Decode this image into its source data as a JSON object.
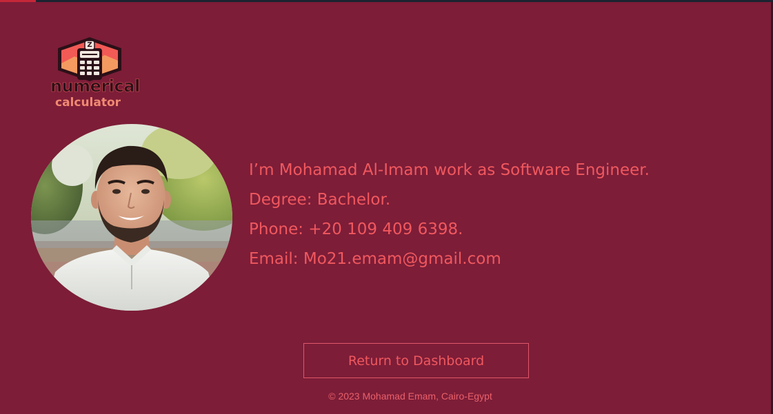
{
  "logo": {
    "word1": "numerical",
    "word2": "calculator",
    "badge_letter": "Z"
  },
  "photo": {
    "alt": "Profile photo"
  },
  "info": {
    "intro": "I’m Mohamad Al-Imam work as Software Engineer.",
    "degree": "Degree: Bachelor.",
    "phone": "Phone: +20 109 409 6398.",
    "email": "Email: Mo21.emam@gmail.com"
  },
  "return_button": {
    "label": "Return to Dashboard"
  },
  "footer": {
    "copyright": "© 2023 Mohamad Emam, Cairo-Egypt"
  },
  "colors": {
    "background": "#7d1d38",
    "accent_text": "#f0585e",
    "button_border": "#e0576a"
  }
}
